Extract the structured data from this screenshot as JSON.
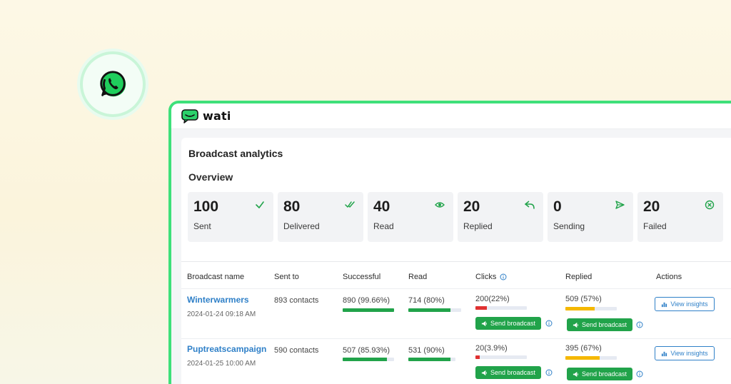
{
  "app": {
    "name": "wati"
  },
  "page": {
    "title": "Broadcast analytics",
    "subtitle": "Overview"
  },
  "colors": {
    "accent": "#21a34a",
    "link": "#2f80c8",
    "red": "#e03131",
    "yellow": "#f5b800",
    "frame": "#3ee07a"
  },
  "stats": [
    {
      "value": "100",
      "label": "Sent",
      "icon": "check-icon"
    },
    {
      "value": "80",
      "label": "Delivered",
      "icon": "double-check-icon"
    },
    {
      "value": "40",
      "label": "Read",
      "icon": "eye-icon"
    },
    {
      "value": "20",
      "label": "Replied",
      "icon": "reply-icon"
    },
    {
      "value": "0",
      "label": "Sending",
      "icon": "send-icon"
    },
    {
      "value": "20",
      "label": "Failed",
      "icon": "failed-icon"
    }
  ],
  "table": {
    "headers": [
      "Broadcast name",
      "Sent to",
      "Successful",
      "Read",
      "Clicks",
      "Replied",
      "Actions"
    ],
    "send_label": "Send broadcast",
    "insights_label": "View insights",
    "rows": [
      {
        "name": "Winterwarmers",
        "date": "2024-01-24 09:18 AM",
        "sent_to": "893 contacts",
        "successful": "890 (99.66%)",
        "successful_pct": 99.66,
        "read": "714 (80%)",
        "read_pct": 80,
        "clicks": "200(22%)",
        "clicks_pct": 22,
        "replied": "509 (57%)",
        "replied_pct": 57
      },
      {
        "name": "Puptreatscampaign",
        "date": "2024-01-25 10:00 AM",
        "sent_to": "590 contacts",
        "successful": "507 (85.93%)",
        "successful_pct": 85.93,
        "read": "531 (90%)",
        "read_pct": 90,
        "clicks": "20(3.9%)",
        "clicks_pct": 3.9,
        "replied": "395 (67%)",
        "replied_pct": 67
      }
    ]
  }
}
